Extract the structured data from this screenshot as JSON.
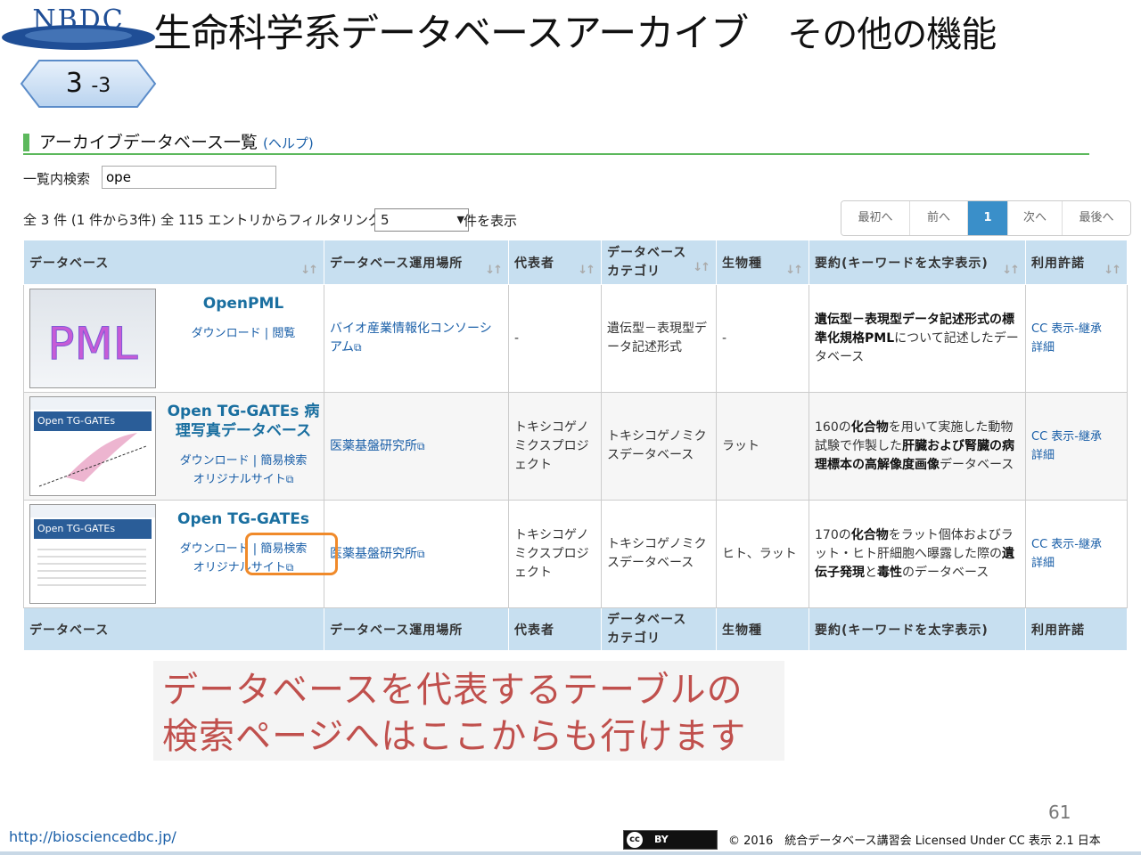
{
  "header": {
    "logo_text": "NBDC",
    "title": "生命科学系データベースアーカイブ",
    "subtitle": "その他の機能",
    "section_number": "3",
    "section_sub": "-3"
  },
  "section": {
    "heading": "アーカイブデータベース一覧",
    "help": "(ヘルプ)"
  },
  "search": {
    "label": "一覧内検索",
    "value": "ope"
  },
  "filter": {
    "status": "全 3 件 (1 件から3件) 全 115 エントリからフィルタリング",
    "page_size": "5",
    "page_size_suffix": "件を表示"
  },
  "pager": {
    "first": "最初へ",
    "prev": "前へ",
    "current": "1",
    "next": "次へ",
    "last": "最後へ"
  },
  "table": {
    "columns": [
      "データベース",
      "データベース運用場所",
      "代表者",
      "データベース",
      "カテゴリ",
      "生物種",
      "要約(キーワードを太字表示)",
      "利用許諾"
    ],
    "rows": [
      {
        "thumb_text": "PML",
        "name": "OpenPML",
        "link1": "ダウンロード",
        "sep": "|",
        "link2": "閲覧",
        "location": "バイオ産業情報化コンソーシアム",
        "rep": "-",
        "category": "遺伝型－表現型データ記述形式",
        "species": "-",
        "summary_b1": "遺伝型－表現型データ記述形式の標準化規格PML",
        "summary_t1": "について記述したデータベース",
        "license": "CC 表示-継承",
        "detail": "詳細"
      },
      {
        "thumb_text": "Open TG-GATEs",
        "name": "Open TG-GATEs 病理写真データベース",
        "link1": "ダウンロード",
        "sep": "|",
        "link2": "簡易検索",
        "link3": "オリジナルサイト",
        "location": "医薬基盤研究所",
        "rep": "トキシコゲノミクスプロジェクト",
        "category": "トキシコゲノミクスデータベース",
        "species": "ラット",
        "summary_t1": "160の",
        "summary_b1": "化合物",
        "summary_t2": "を用いて実施した動物試験で作製した",
        "summary_b2": "肝臓および腎臓の病理標本の高解像度画像",
        "summary_t3": "データベース",
        "license": "CC 表示-継承",
        "detail": "詳細"
      },
      {
        "thumb_text": "Open TG-GATEs",
        "name": "Open TG-GATEs",
        "link1": "ダウンロード",
        "sep": "|",
        "link2": "簡易検索",
        "link3": "オリジナルサイト",
        "location": "医薬基盤研究所",
        "rep": "トキシコゲノミクスプロジェクト",
        "category": "トキシコゲノミクスデータベース",
        "species": "ヒト、ラット",
        "summary_t1": "170の",
        "summary_b1": "化合物",
        "summary_t2": "をラット個体およびラット・ヒト肝細胞へ曝露した際の",
        "summary_b2": "遺伝子発現",
        "summary_t3": "と",
        "summary_b3": "毒性",
        "summary_t4": "のデータベース",
        "license": "CC 表示-継承",
        "detail": "詳細"
      }
    ]
  },
  "callout": {
    "line1": "データベースを代表するテーブルの",
    "line2": "検索ページへはここからも行けます"
  },
  "footer": {
    "page_number": "61",
    "url": "http://biosciencedbc.jp/",
    "cc_badge": "cc BY",
    "copyright": "© 2016　統合データベース講習会 Licensed Under CC 表示 2.1 日本"
  }
}
